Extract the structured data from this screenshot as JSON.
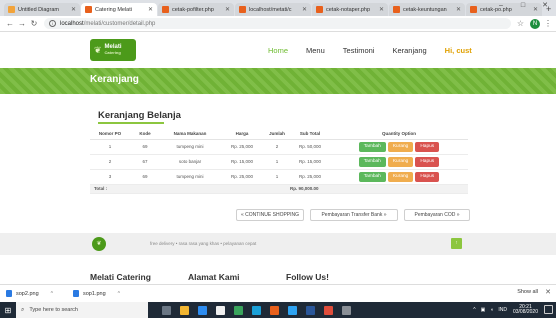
{
  "browser": {
    "tabs": [
      {
        "label": "Untitled Diagram",
        "color": "#f2a33a",
        "active": false
      },
      {
        "label": "Catering Melati",
        "color": "#e8601c",
        "active": true
      },
      {
        "label": "cetak-pofilter.php",
        "color": "#e8601c",
        "active": false
      },
      {
        "label": "localhost/metati/c",
        "color": "#e8601c",
        "active": false
      },
      {
        "label": "cetak-notaper.php",
        "color": "#e8601c",
        "active": false
      },
      {
        "label": "cetak-keuntungan",
        "color": "#e8601c",
        "active": false
      },
      {
        "label": "cetak-po.php",
        "color": "#e8601c",
        "active": false
      }
    ],
    "new_tab": "+",
    "window_controls": {
      "minimize": "–",
      "maximize": "□",
      "close": "✕"
    },
    "url_host": "localhost",
    "url_path": "/melati/customer/detail.php",
    "profile_initial": "N"
  },
  "site": {
    "logo_title": "Melati",
    "logo_subtitle": "Catering",
    "nav": [
      {
        "label": "Home",
        "active": true
      },
      {
        "label": "Menu",
        "active": false
      },
      {
        "label": "Testimoni",
        "active": false
      },
      {
        "label": "Keranjang",
        "active": false
      }
    ],
    "user_greeting": "Hi, cust",
    "banner_title": "Keranjang"
  },
  "cart": {
    "heading": "Keranjang Belanja",
    "columns": [
      "Nomor PO",
      "Kode",
      "Nama Makanan",
      "Harga",
      "Jumlah",
      "Sub Total",
      "Quantity Option"
    ],
    "rows": [
      {
        "no": "1",
        "kode": "69",
        "nama": "tumpeng mini",
        "harga": "Rp. 25,000",
        "jumlah": "2",
        "subtotal": "Rp. 50,000"
      },
      {
        "no": "2",
        "kode": "67",
        "nama": "soto banjar",
        "harga": "Rp. 15,000",
        "jumlah": "1",
        "subtotal": "Rp. 15,000"
      },
      {
        "no": "3",
        "kode": "69",
        "nama": "tumpeng mini",
        "harga": "Rp. 25,000",
        "jumlah": "1",
        "subtotal": "Rp. 25,000"
      }
    ],
    "option_labels": {
      "add": "Tambah",
      "reduce": "Kurang",
      "remove": "Hapus"
    },
    "total_label": "Total :",
    "total_value": "Rp. 90,000.00",
    "continue_button": "« CONTINUE SHOPPING",
    "transfer_button": "Pembayaran Transfer Bank »",
    "cod_button": "Pembayaran COD »"
  },
  "strip": {
    "tagline": "free delivery • rasa rasa yang khas • pelayanan cepat",
    "to_top": "↑"
  },
  "footer": {
    "col1": "Melati Catering",
    "col2": "Alamat Kami",
    "col3": "Follow Us!"
  },
  "downloads": {
    "items": [
      "sop2.png",
      "sop1.png"
    ],
    "show_all": "Show all"
  },
  "taskbar": {
    "search_placeholder": "Type here to search",
    "time": "20:21",
    "date": "03/08/2020",
    "lang": "IND"
  }
}
